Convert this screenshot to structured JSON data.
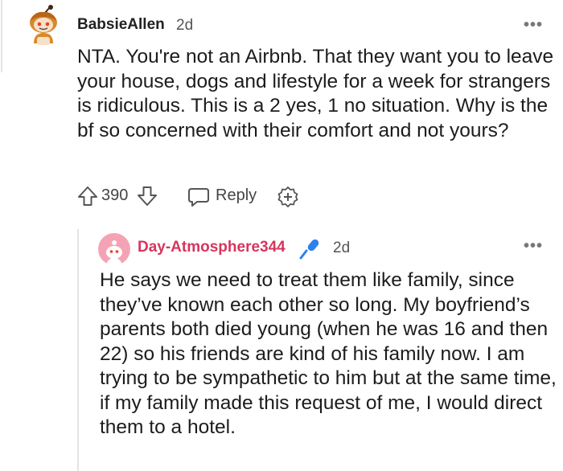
{
  "comment": {
    "author": "BabsieAllen",
    "time": "2d",
    "more": "•••",
    "body": "NTA. You're not an Airbnb. That they want you to leave your house, dogs and lifestyle for a week for strangers is ridiculous. This is a 2 yes, 1 no situation. Why is the bf so concerned with their comfort and not yours?",
    "score": "390",
    "reply_label": "Reply"
  },
  "reply": {
    "author": "Day-Atmosphere344",
    "time": "2d",
    "more": "•••",
    "body": "He says we need to treat them like family, since they’ve known each other so long. My boyfriend’s parents both died young (when he was 16 and then 22) so his friends are kind of his family now. I am trying to be sympathetic to him but at the same time, if my family made this request of me, I would direct them to a hotel."
  },
  "colors": {
    "username_accent": "#d4365c",
    "mic_badge": "#2f80ed",
    "avatar2_bg": "#f4a3b5"
  },
  "icons": [
    "upvote-icon",
    "downvote-icon",
    "reply-bubble-icon",
    "award-plus-icon",
    "microphone-icon",
    "overflow-menu-icon"
  ]
}
